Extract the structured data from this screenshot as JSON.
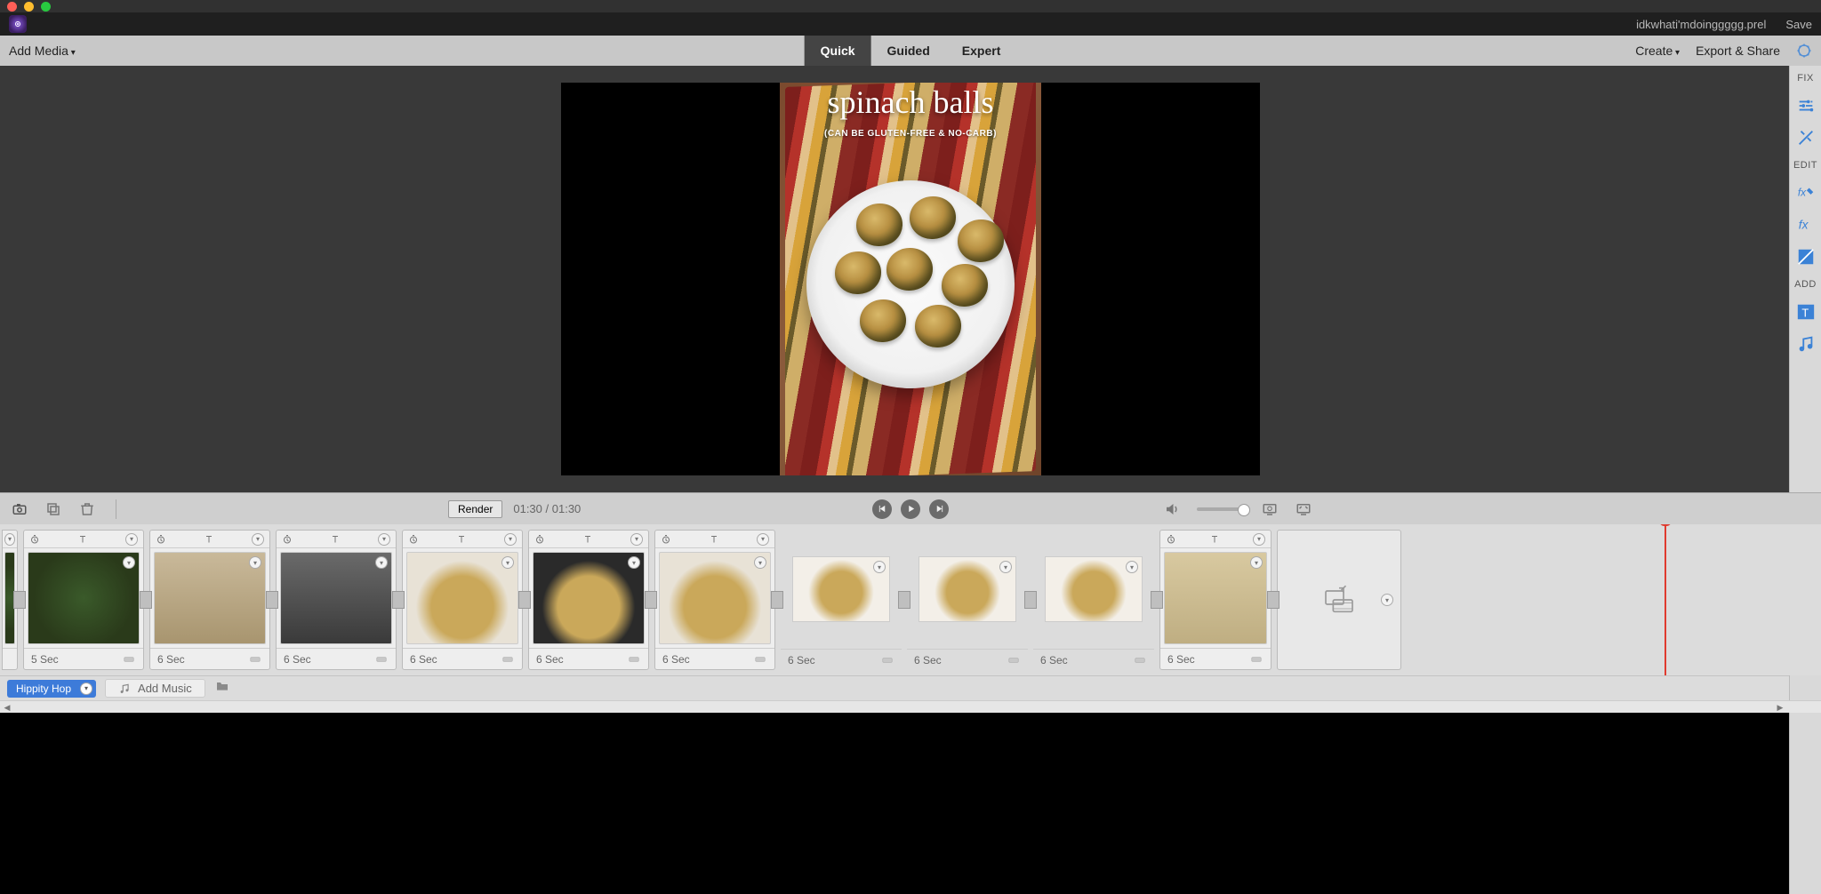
{
  "project_filename": "idkwhati'mdoinggggg.prel",
  "save_label": "Save",
  "toolbar": {
    "add_media": "Add Media",
    "tabs": {
      "quick": "Quick",
      "guided": "Guided",
      "expert": "Expert"
    },
    "create": "Create",
    "export_share": "Export & Share"
  },
  "preview": {
    "title_script": "spinach balls",
    "title_sub": "(CAN BE GLUTEN-FREE & NO-CARB)"
  },
  "side_rail": {
    "fix": "FIX",
    "edit": "EDIT",
    "add": "ADD"
  },
  "controls": {
    "render": "Render",
    "time_current": "01:30",
    "time_total": "01:30"
  },
  "clips": [
    {
      "duration": "5 Sec"
    },
    {
      "duration": "6 Sec"
    },
    {
      "duration": "6 Sec"
    },
    {
      "duration": "6 Sec"
    },
    {
      "duration": "6 Sec"
    },
    {
      "duration": "6 Sec"
    },
    {
      "duration": "6 Sec"
    },
    {
      "duration": "6 Sec"
    },
    {
      "duration": "6 Sec"
    },
    {
      "duration": "6 Sec"
    }
  ],
  "audio": {
    "track_name": "Hippity Hop",
    "add_music": "Add Music"
  }
}
